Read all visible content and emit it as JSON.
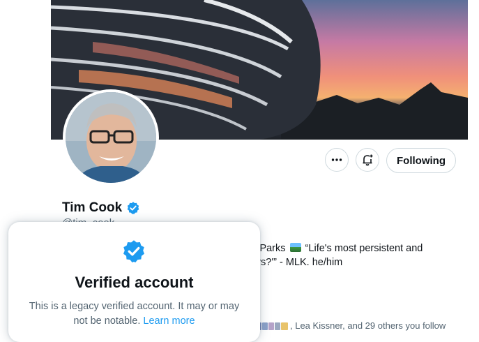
{
  "profile": {
    "name": "Tim Cook",
    "handle": "@tim_cook",
    "verified": true,
    "bio_line1": "onal Parks",
    "bio_quote": "“Life's most persistent and",
    "bio_line2": "others?'” - MLK. he/him",
    "followers_known": ", Lea Kissner, and 29 others you follow"
  },
  "actions": {
    "more_icon": "more-horizontal-icon",
    "notify_icon": "bell-plus-icon",
    "follow_label": "Following"
  },
  "verified_popup": {
    "title": "Verified account",
    "description": "This is a legacy verified account. It may or may not be notable.",
    "link_label": "Learn more"
  },
  "colors": {
    "accent": "#1d9bf0",
    "text": "#0f1419",
    "secondary_text": "#536471",
    "border": "#cfd9de"
  }
}
